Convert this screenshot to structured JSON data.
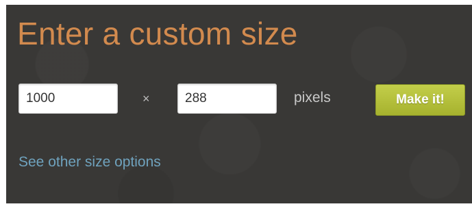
{
  "title": "Enter a custom size",
  "width_input": {
    "value": "1000"
  },
  "separator": "×",
  "height_input": {
    "value": "288"
  },
  "unit_label": "pixels",
  "make_button": {
    "label": "Make it!"
  },
  "other_sizes_link": "See other size options",
  "colors": {
    "panel_background": "#393836",
    "title": "#d28a4e",
    "button": "#b5c03b",
    "link": "#6fa2bd"
  }
}
